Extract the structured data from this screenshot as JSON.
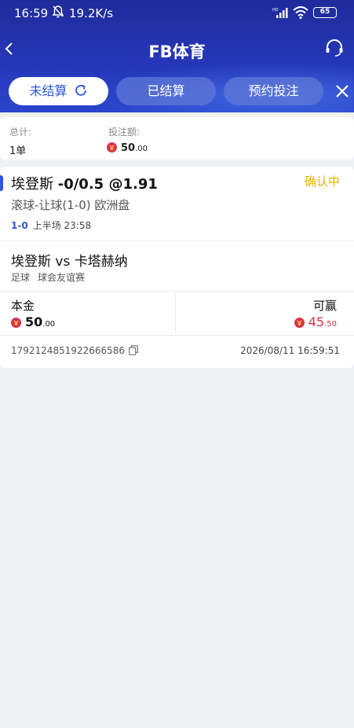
{
  "status_bar": {
    "time": "16:59",
    "speed": "19.2K/s",
    "battery": "65",
    "icons": [
      "bell-off-icon",
      "hd-signal-icon",
      "wifi-icon",
      "battery-icon"
    ]
  },
  "nav": {
    "title": "FB体育",
    "back_icon": "chevron-left-icon",
    "support_icon": "headset-icon"
  },
  "tabs": [
    {
      "label": "未结算",
      "active": true
    },
    {
      "label": "已结算",
      "active": false
    },
    {
      "label": "预约投注",
      "active": false
    }
  ],
  "summary": {
    "total_label": "总计:",
    "total_value": "1单",
    "bet_amount_label": "投注额:",
    "bet_amount_int": "50",
    "bet_amount_dec": ".00"
  },
  "bet": {
    "selection": "埃登斯",
    "line_odds": "-0/0.5 @1.91",
    "status": "确认中",
    "market": "滚球-让球(1-0) 欧洲盘",
    "score": "1-0",
    "period": "上半场 23:58",
    "match": "埃登斯 vs 卡塔赫纳",
    "sport": "足球",
    "league": "球会友谊赛",
    "stake_label": "本金",
    "stake_int": "50",
    "stake_dec": ".00",
    "win_label": "可赢",
    "win_int": "45",
    "win_dec": ".50",
    "order_id": "1792124851922666586",
    "order_time": "2026/08/11 16:59:51"
  },
  "colors": {
    "header": "#2537b8",
    "accent": "#2d56e6",
    "pending": "#e6b400",
    "win": "#d8324a"
  }
}
